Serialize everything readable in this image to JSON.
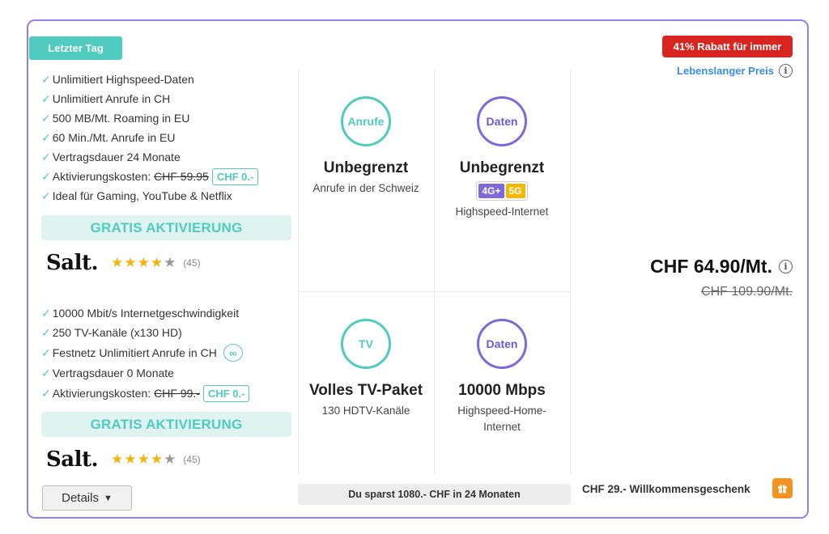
{
  "badges": {
    "last_day": "Letzter Tag",
    "discount": "41% Rabatt für immer",
    "lifetime_price": "Lebenslanger Preis"
  },
  "offer1": {
    "features": [
      "Unlimitiert Highspeed-Daten",
      "Unlimitiert Anrufe in CH",
      "500 MB/Mt. Roaming in EU",
      "60 Min./Mt. Anrufe in EU",
      "Vertragsdauer 24 Monate"
    ],
    "activation_label": "Aktivierungskosten:",
    "activation_old": "CHF 59.95",
    "activation_new": "CHF 0.-",
    "feature_last": "Ideal für Gaming, YouTube & Netflix",
    "gratis": "GRATIS AKTIVIERUNG",
    "brand": "Salt.",
    "rating": 4,
    "reviews": "(45)",
    "tiles": [
      {
        "icon_label": "Anrufe",
        "title": "Unbegrenzt",
        "sub": "Anrufe in der Schweiz"
      },
      {
        "icon_label": "Daten",
        "title": "Unbegrenzt",
        "badge_4g": "4G+",
        "badge_5g": "5G",
        "sub": "Highspeed-Internet"
      }
    ]
  },
  "offer2": {
    "feature1": "10000 Mbit/s Internetgeschwindigkeit",
    "feature2": "250 TV-Kanäle (x130 HD)",
    "feature3": "Festnetz Unlimitiert Anrufe in CH",
    "feature3_chip": "∞",
    "feature4": "Vertragsdauer 0 Monate",
    "activation_label": "Aktivierungskosten:",
    "activation_old": "CHF 99.-",
    "activation_new": "CHF 0.-",
    "gratis": "GRATIS AKTIVIERUNG",
    "brand": "Salt.",
    "rating": 4,
    "reviews": "(45)",
    "tiles": [
      {
        "icon_label": "TV",
        "title": "Volles TV-Paket",
        "sub": "130 HDTV-Kanäle"
      },
      {
        "icon_label": "Daten",
        "title": "10000 Mbps",
        "sub": "Highspeed-Home-Internet"
      }
    ]
  },
  "price": {
    "current": "CHF 64.90/Mt.",
    "old": "CHF 109.90/Mt."
  },
  "footer": {
    "details": "Details",
    "savings": "Du sparst 1080.- CHF in 24 Monaten",
    "gift": "CHF 29.- Willkommensgeschenk"
  },
  "icons": {
    "info": "info-icon",
    "check": "check-icon",
    "star": "star-icon",
    "caret": "caret-down-icon",
    "gift": "gift-icon"
  },
  "colors": {
    "accent_teal": "#4fcbbf",
    "accent_purple": "#7b6ad8",
    "discount_red": "#d8251f",
    "star_yellow": "#f2b40f",
    "gift_orange": "#f39320",
    "link_blue": "#3a8dde"
  }
}
